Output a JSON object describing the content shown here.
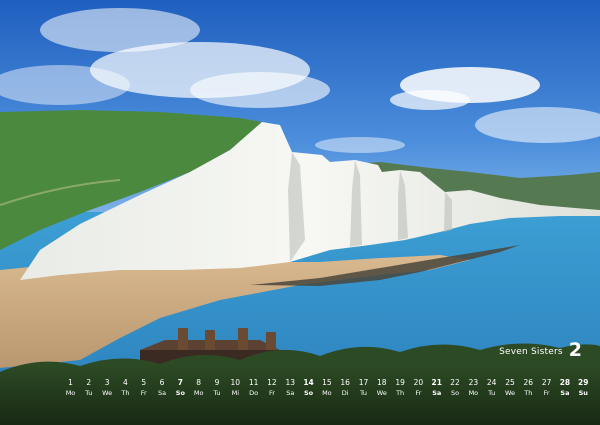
{
  "calendar": {
    "location": "Seven Sisters",
    "month": "2",
    "days": [
      {
        "n": "1",
        "d": "Mo"
      },
      {
        "n": "2",
        "d": "Tu"
      },
      {
        "n": "3",
        "d": "We"
      },
      {
        "n": "4",
        "d": "Th"
      },
      {
        "n": "5",
        "d": "Fr"
      },
      {
        "n": "6",
        "d": "Sa"
      },
      {
        "n": "7",
        "d": "So"
      },
      {
        "n": "8",
        "d": "Mo"
      },
      {
        "n": "9",
        "d": "Tu"
      },
      {
        "n": "10",
        "d": "Mi"
      },
      {
        "n": "11",
        "d": "Do"
      },
      {
        "n": "12",
        "d": "Fr"
      },
      {
        "n": "13",
        "d": "Sa"
      },
      {
        "n": "14",
        "d": "So"
      },
      {
        "n": "15",
        "d": "Mo"
      },
      {
        "n": "16",
        "d": "Di"
      },
      {
        "n": "17",
        "d": "Tu"
      },
      {
        "n": "18",
        "d": "We"
      },
      {
        "n": "19",
        "d": "Th"
      },
      {
        "n": "20",
        "d": "Fr"
      },
      {
        "n": "21",
        "d": "Sa"
      },
      {
        "n": "22",
        "d": "So"
      },
      {
        "n": "23",
        "d": "Mo"
      },
      {
        "n": "24",
        "d": "Tu"
      },
      {
        "n": "25",
        "d": "We"
      },
      {
        "n": "26",
        "d": "Th"
      },
      {
        "n": "27",
        "d": "Fr"
      },
      {
        "n": "28",
        "d": "Sa"
      },
      {
        "n": "29",
        "d": "Su"
      }
    ]
  }
}
